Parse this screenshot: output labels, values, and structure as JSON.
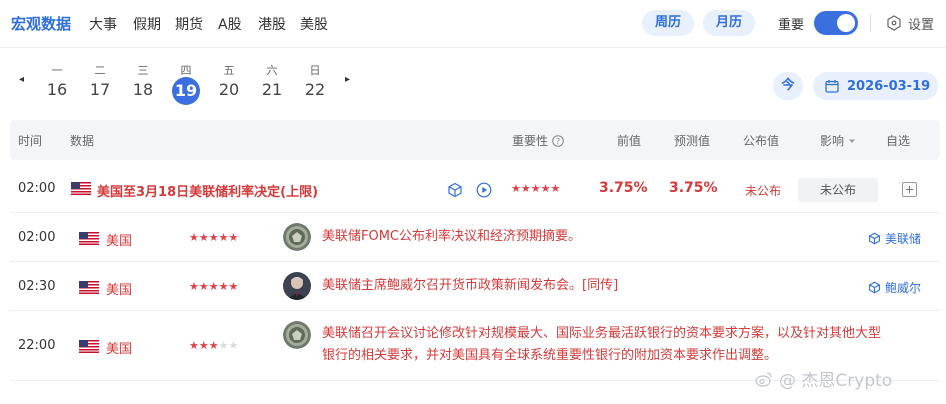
{
  "nav": {
    "tabs": [
      "宏观数据",
      "大事",
      "假期",
      "期货",
      "A股",
      "港股",
      "美股"
    ],
    "week_view": "周历",
    "month_view": "月历",
    "importance_label": "重要",
    "importance_toggle": "on",
    "settings_label": "设置"
  },
  "date_bar": {
    "prev_arrow": "◂",
    "next_arrow": "▸",
    "days": [
      {
        "weekday": "一",
        "date": "16"
      },
      {
        "weekday": "二",
        "date": "17"
      },
      {
        "weekday": "三",
        "date": "18"
      },
      {
        "weekday": "四",
        "date": "19",
        "selected": true
      },
      {
        "weekday": "五",
        "date": "20"
      },
      {
        "weekday": "六",
        "date": "21"
      },
      {
        "weekday": "日",
        "date": "22"
      }
    ],
    "today_label": "今",
    "current_date": "2026-03-19"
  },
  "table": {
    "headers": {
      "time": "时间",
      "data": "数据",
      "importance": "重要性",
      "previous": "前值",
      "forecast": "预测值",
      "actual": "公布值",
      "impact": "影响",
      "watchlist": "自选"
    },
    "data_row": {
      "time": "02:00",
      "country_flag": "us-flag",
      "title": "美国至3月18日美联储利率决定(上限)",
      "stars": 5,
      "previous": "3.75%",
      "forecast": "3.75%",
      "actual": "未公布",
      "impact": "未公布"
    },
    "events": [
      {
        "time": "02:00",
        "country": "美国",
        "stars": 5,
        "avatar": "fed-seal",
        "desc_line1": "美联储FOMC公布利率决议和经济预期摘要。",
        "desc_line2": "",
        "tag": "美联储",
        "tag_icon": "cube-icon"
      },
      {
        "time": "02:30",
        "country": "美国",
        "stars": 5,
        "avatar": "powell-portrait",
        "desc_line1": "美联储主席鲍威尔召开货币政策新闻发布会。[同传]",
        "desc_line2": "",
        "tag": "鲍威尔",
        "tag_icon": "cube-icon"
      },
      {
        "time": "22:00",
        "country": "美国",
        "stars": 3,
        "avatar": "fed-seal",
        "desc_line1": "美联储召开会议讨论修改针对规模最大、国际业务最活跃银行的资本要求方案，以及针对其他大型",
        "desc_line2": "银行的相关要求，并对美国具有全球系统重要性银行的附加资本要求作出调整。",
        "tag": "",
        "tag_icon": ""
      }
    ]
  },
  "watermark": "@ 杰恩Crypto",
  "colors": {
    "accent": "#3b6fe0",
    "accent_text": "#2f6fdb",
    "pill_bg": "#e8f0fd",
    "red": "#d43a3a",
    "star": "#e0414a"
  }
}
